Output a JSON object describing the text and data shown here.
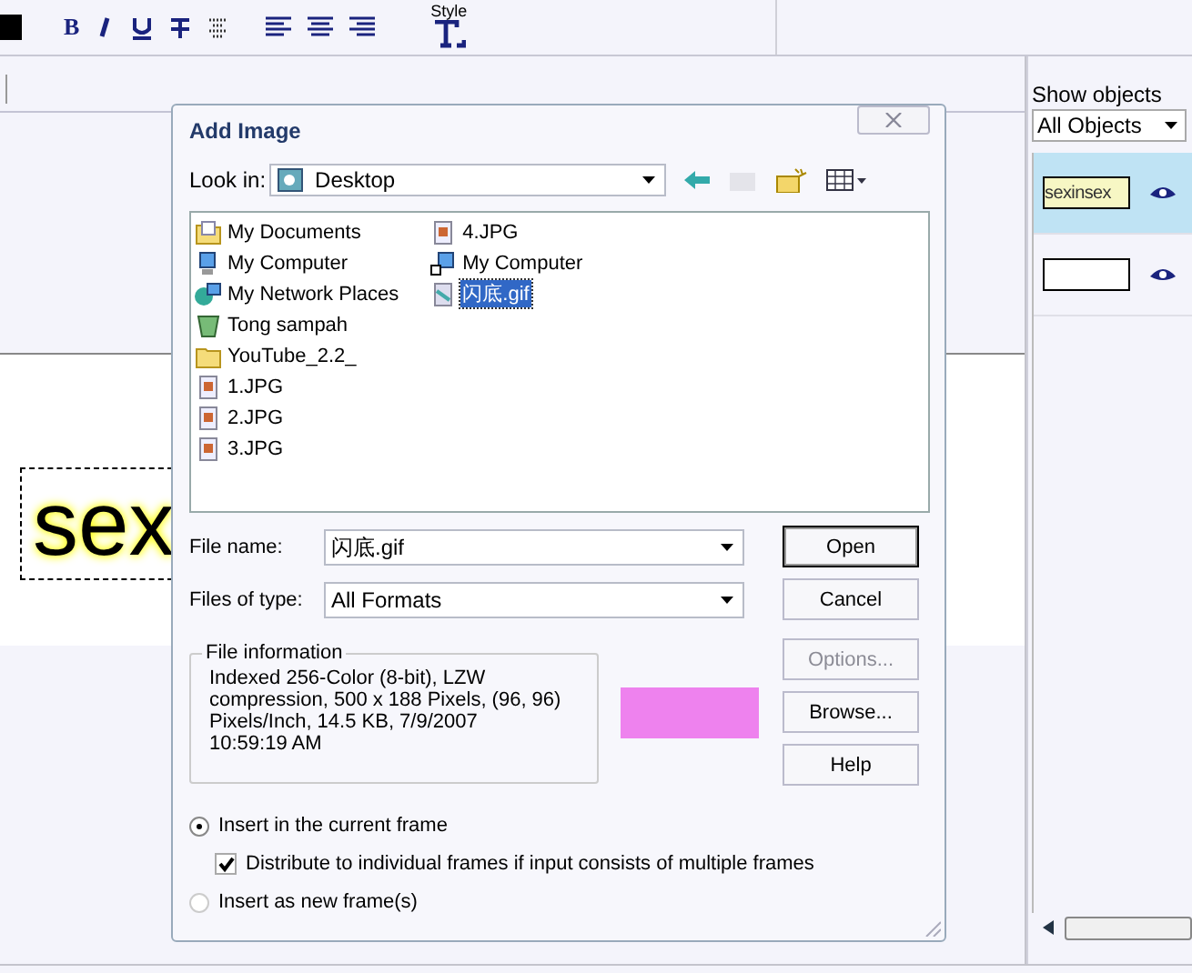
{
  "toolbar": {
    "bold_label": "B",
    "style_label": "Style"
  },
  "canvas": {
    "text": "sex"
  },
  "objects_panel": {
    "label": "Show objects",
    "filter": "All Objects",
    "items": [
      {
        "kind": "text",
        "label": "sexinsex",
        "selected": true
      },
      {
        "kind": "blank",
        "selected": false
      }
    ]
  },
  "dialog": {
    "title": "Add Image",
    "look_in": {
      "label": "Look in:",
      "value": "Desktop"
    },
    "files": [
      {
        "kind": "documents",
        "name": "My Documents",
        "selected": false
      },
      {
        "kind": "computer",
        "name": "My Computer",
        "selected": false
      },
      {
        "kind": "network",
        "name": "My Network Places",
        "selected": false
      },
      {
        "kind": "recycle",
        "name": "Tong sampah",
        "selected": false
      },
      {
        "kind": "folder",
        "name": "YouTube_2.2_",
        "selected": false
      },
      {
        "kind": "image",
        "name": "1.JPG",
        "selected": false
      },
      {
        "kind": "image",
        "name": "2.JPG",
        "selected": false
      },
      {
        "kind": "image",
        "name": "3.JPG",
        "selected": false
      },
      {
        "kind": "image",
        "name": "4.JPG",
        "selected": false
      },
      {
        "kind": "shortcut",
        "name": "My Computer",
        "selected": false
      },
      {
        "kind": "gif",
        "name": "闪底.gif",
        "selected": true
      }
    ],
    "file_name": {
      "label": "File name:",
      "value": "闪底.gif"
    },
    "file_type": {
      "label": "Files of type:",
      "value": "All Formats"
    },
    "file_info": {
      "label": "File information",
      "lines": [
        "Indexed 256-Color (8-bit),  LZW",
        "compression, 500 x 188 Pixels,  (96, 96)",
        "Pixels/Inch,  14.5 KB,  7/9/2007",
        "10:59:19 AM"
      ]
    },
    "buttons": [
      {
        "label": "Open",
        "default": true,
        "disabled": false
      },
      {
        "label": "Cancel",
        "default": false,
        "disabled": false
      },
      {
        "label": "Options...",
        "default": false,
        "disabled": true
      },
      {
        "label": "Browse...",
        "default": false,
        "disabled": false
      },
      {
        "label": "Help",
        "default": false,
        "disabled": false
      }
    ],
    "options": [
      {
        "kind": "radio",
        "label": "Insert in the current frame",
        "checked": true
      },
      {
        "kind": "checkbox",
        "label": "Distribute to individual frames if input consists of multiple frames",
        "checked": true
      },
      {
        "kind": "radio",
        "label": "Insert as new frame(s)",
        "checked": false
      }
    ]
  }
}
